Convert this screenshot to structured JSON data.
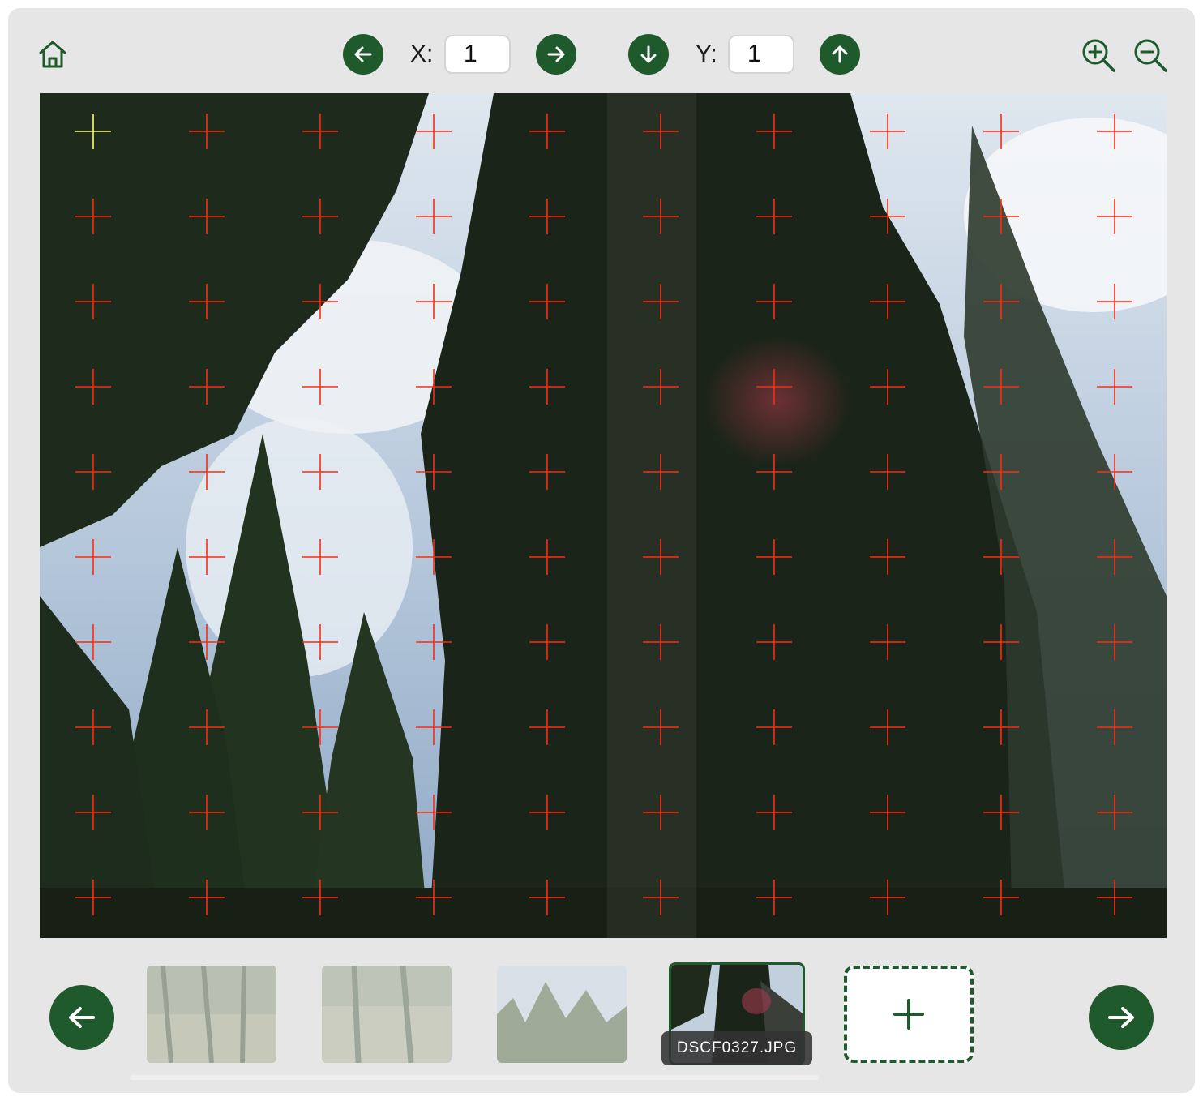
{
  "toolbar": {
    "home_icon": "home-icon",
    "x_label": "X:",
    "x_value": "1",
    "y_label": "Y:",
    "y_value": "1",
    "zoom_in_icon": "zoom-in-icon",
    "zoom_out_icon": "zoom-out-icon"
  },
  "grid": {
    "columns": 10,
    "rows": 10,
    "selected": {
      "x": 1,
      "y": 1
    }
  },
  "thumbnails": [
    {
      "name": "",
      "active": false
    },
    {
      "name": "",
      "active": false
    },
    {
      "name": "",
      "active": false
    },
    {
      "name": "DSCF0327.JPG",
      "active": true
    }
  ],
  "add_image_icon": "plus-icon",
  "colors": {
    "accent": "#1f5a2c",
    "marker": "#ff2a10",
    "marker_selected": "#ffff66"
  }
}
